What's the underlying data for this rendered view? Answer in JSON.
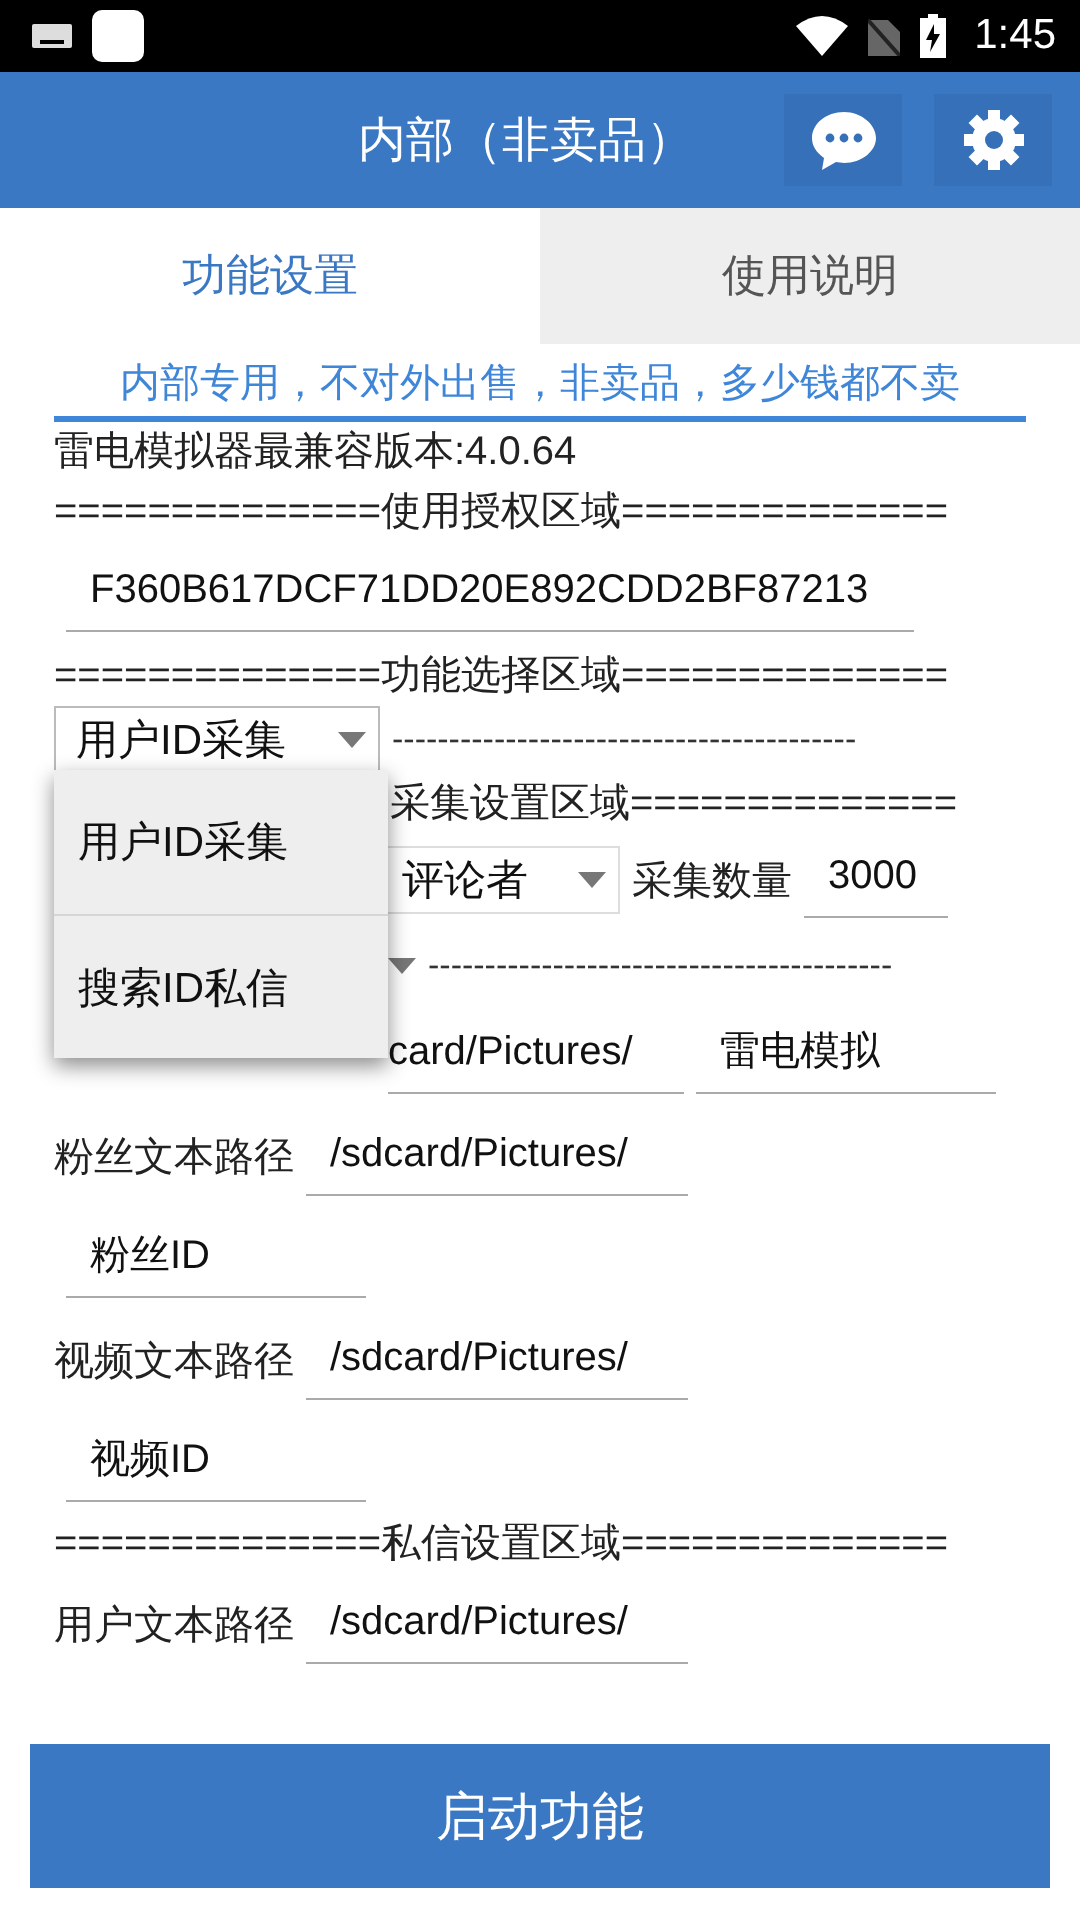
{
  "status_bar": {
    "time": "1:45"
  },
  "app_bar": {
    "title": "内部（非卖品）"
  },
  "tabs": [
    {
      "label": "功能设置",
      "selected": true
    },
    {
      "label": "使用说明",
      "selected": false
    }
  ],
  "notice": "内部专用，不对外出售，非卖品，多少钱都不卖",
  "version": "雷电模拟器最兼容版本:4.0.64",
  "license_heading": "==============使用授权区域==============",
  "license_key": "F360B617DCF71DD20E892CDD2BF87213",
  "function_heading": "==============功能选择区域==============",
  "function_select": {
    "value": "用户ID采集",
    "expanded": true,
    "trailer": "-----------------------------------------"
  },
  "function_options": [
    {
      "label": "用户ID采集"
    },
    {
      "label": "搜索ID私信"
    }
  ],
  "collect_heading": "采集设置区域==============",
  "collect_type": {
    "value": "评论者"
  },
  "collect_count": {
    "label": "采集数量",
    "value": "3000"
  },
  "second_select": {
    "trailer": "-----------------------------------------"
  },
  "collect_path": {
    "value": "card/Pictures/",
    "name": "雷电模拟"
  },
  "paths": [
    {
      "label": "粉丝文本路径",
      "value": "/sdcard/Pictures/",
      "file": "粉丝ID"
    },
    {
      "label": "视频文本路径",
      "value": "/sdcard/Pictures/",
      "file": "视频ID"
    }
  ],
  "message_heading": "==============私信设置区域==============",
  "message_path": {
    "label": "用户文本路径",
    "value": "/sdcard/Pictures/"
  },
  "start_button": "启动功能"
}
